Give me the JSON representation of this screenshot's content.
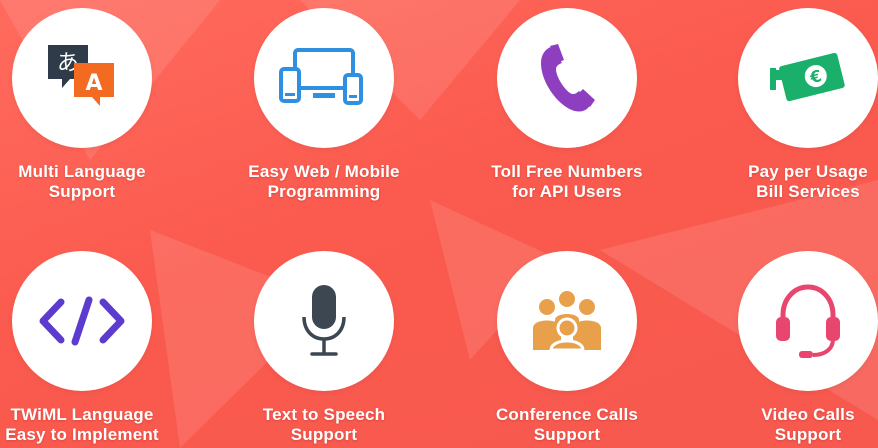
{
  "features": [
    {
      "line1": "Multi Language",
      "line2": "Support",
      "icon": "translate-icon"
    },
    {
      "line1": "Easy Web / Mobile",
      "line2": "Programming",
      "icon": "devices-icon"
    },
    {
      "line1": "Toll Free Numbers",
      "line2": "for API Users",
      "icon": "phone-icon"
    },
    {
      "line1": "Pay per Usage",
      "line2": "Bill Services",
      "icon": "money-icon"
    },
    {
      "line1": "TWiML Language",
      "line2": "Easy to Implement",
      "icon": "code-icon"
    },
    {
      "line1": "Text to Speech",
      "line2": "Support",
      "icon": "microphone-icon"
    },
    {
      "line1": "Conference Calls",
      "line2": "Support",
      "icon": "group-icon"
    },
    {
      "line1": "Video Calls",
      "line2": "Support",
      "icon": "headset-icon"
    }
  ],
  "icon_text": {
    "lang_a": "あ",
    "lang_b": "A"
  },
  "colors": {
    "background": "#fb5a4e",
    "translate_dark": "#2f3b48",
    "translate_orange": "#f26b21",
    "devices_blue": "#2f8fe0",
    "phone_purple": "#8e3fbf",
    "money_green": "#1ab06b",
    "code_purple": "#5b3ccf",
    "mic_dark": "#3d4752",
    "group_orange": "#e8a14a",
    "headset_pink": "#e8466e"
  }
}
